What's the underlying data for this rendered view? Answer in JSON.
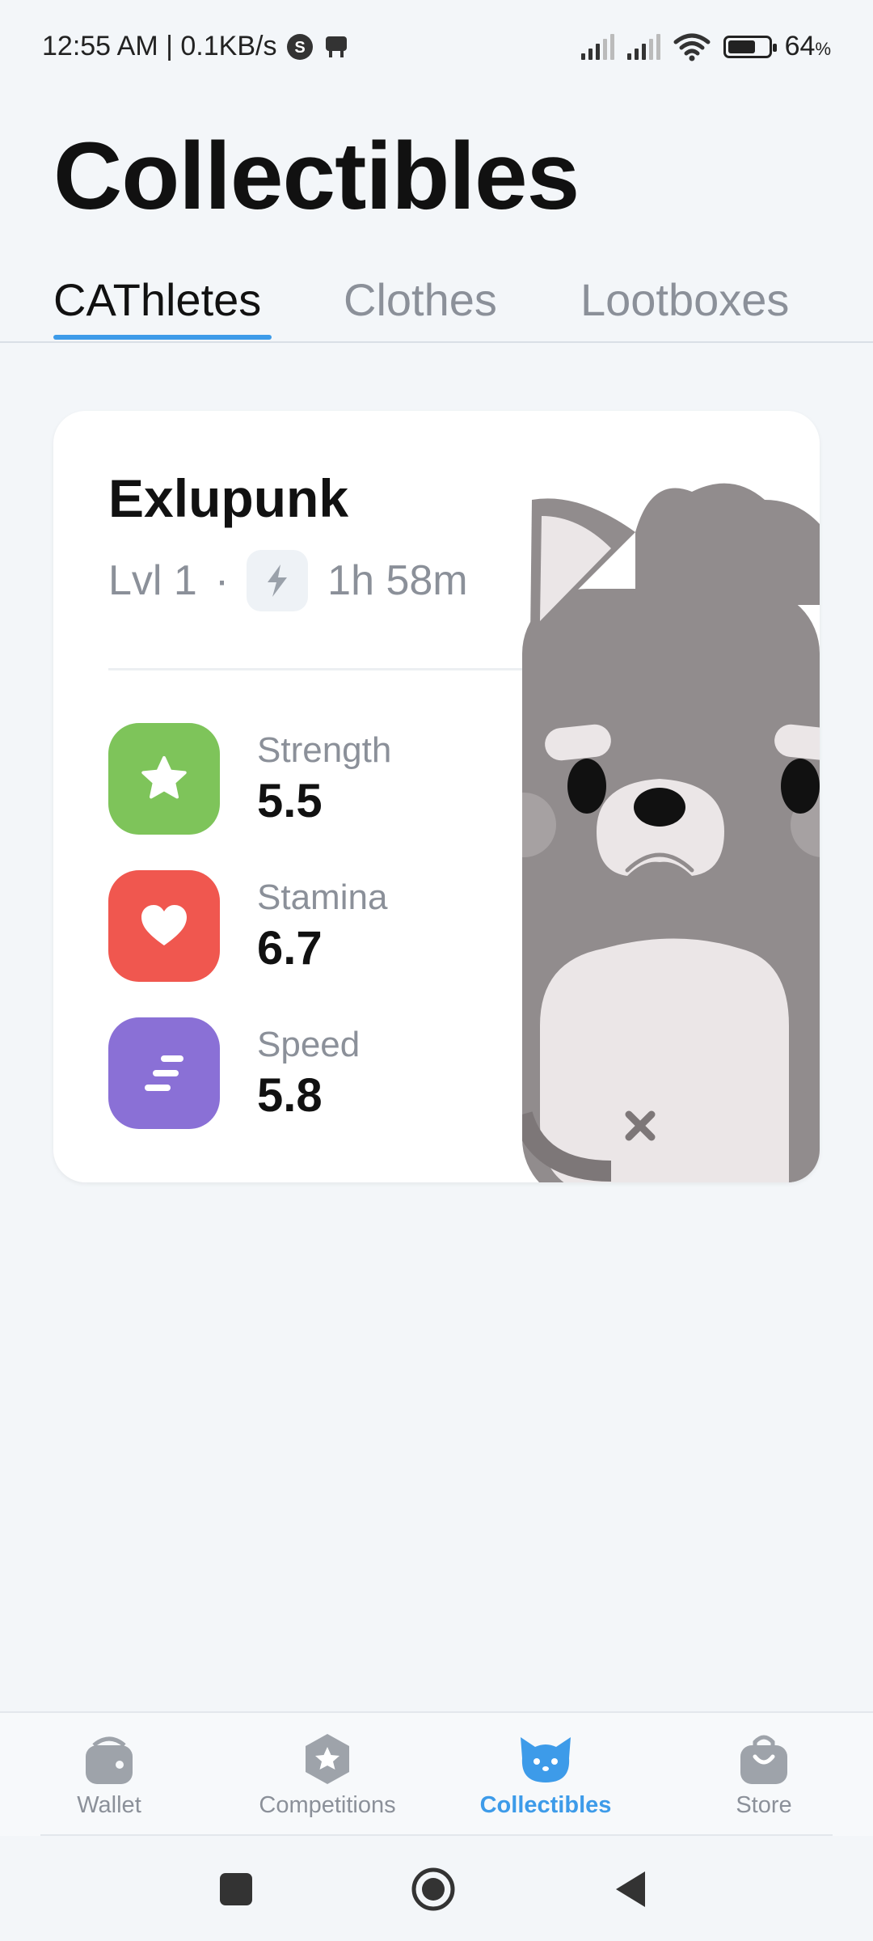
{
  "status_bar": {
    "time_speed": "12:55 AM | 0.1KB/s",
    "battery": "64",
    "battery_unit": "%"
  },
  "page": {
    "title": "Collectibles"
  },
  "tabs": [
    {
      "label": "CAThletes",
      "active": true
    },
    {
      "label": "Clothes",
      "active": false
    },
    {
      "label": "Lootboxes",
      "active": false
    }
  ],
  "card": {
    "name": "Exlupunk",
    "level": "Lvl 1",
    "separator": "·",
    "energy_time": "1h 58m",
    "stats": [
      {
        "label": "Strength",
        "value": "5.5",
        "icon": "star-icon",
        "color": "#7ec45a"
      },
      {
        "label": "Stamina",
        "value": "6.7",
        "icon": "heart-icon",
        "color": "#f0574f"
      },
      {
        "label": "Speed",
        "value": "5.8",
        "icon": "speed-icon",
        "color": "#8a70d6"
      }
    ]
  },
  "bottom_nav": [
    {
      "label": "Wallet",
      "icon": "wallet-icon",
      "active": false
    },
    {
      "label": "Competitions",
      "icon": "competitions-icon",
      "active": false
    },
    {
      "label": "Collectibles",
      "icon": "cat-icon",
      "active": true
    },
    {
      "label": "Store",
      "icon": "shopping-bag-icon",
      "active": false
    }
  ],
  "colors": {
    "accent": "#3d9be9",
    "background": "#f3f6f9",
    "muted": "#8b9099"
  }
}
